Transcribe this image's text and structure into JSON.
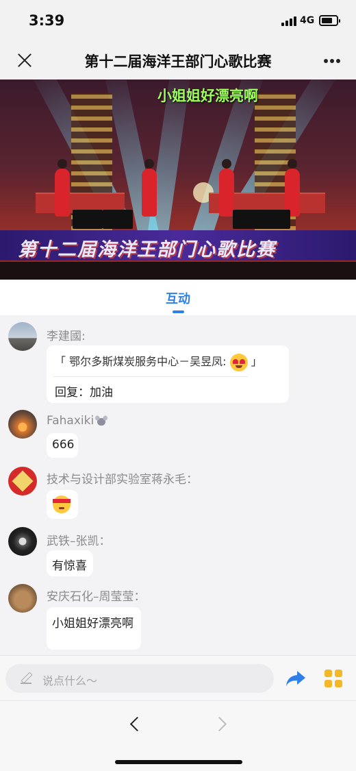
{
  "status_bar": {
    "time": "3:39",
    "network": "4G"
  },
  "header": {
    "title": "第十二届海洋王部门心歌比赛"
  },
  "video": {
    "danmaku": "小姐姐好漂亮啊",
    "stage_banner": "第十二届海洋王部门心歌比赛"
  },
  "tabs": [
    {
      "label": "互动",
      "active": true
    }
  ],
  "messages": [
    {
      "user": "李建國:",
      "quote_prefix": "「 鄂尔多斯煤炭服务中心－吴昱凤:",
      "quote_emoji": "heart-eyes-emoji",
      "quote_suffix": "」",
      "reply": "回复：加油"
    },
    {
      "user": "Fahaxiki",
      "user_icon": "mouse-emoji",
      "text": "666"
    },
    {
      "user": "技术与设计部实验室蒋永毛：",
      "emoji": "headband-emoji"
    },
    {
      "user": "武铁–张凯：",
      "text": "有惊喜"
    },
    {
      "user": "安庆石化–周莹莹：",
      "text": "小姐姐好漂亮啊"
    }
  ],
  "composer": {
    "placeholder": "说点什么～"
  },
  "colors": {
    "accent": "#2f7fe8",
    "danmaku": "#9dff5a",
    "grid_icon": "#f4b728"
  }
}
